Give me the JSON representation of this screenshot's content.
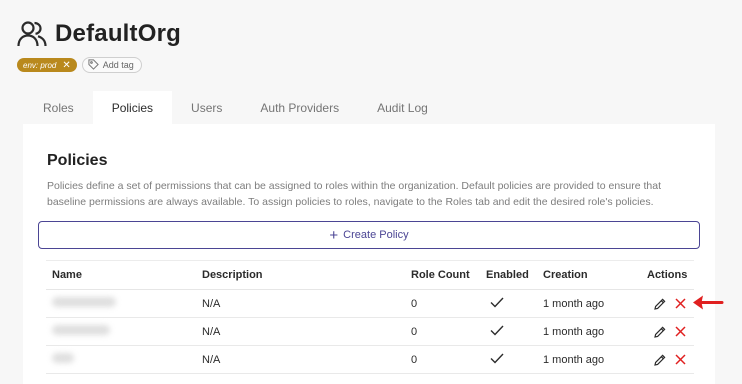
{
  "org": {
    "title": "DefaultOrg",
    "icon": "users-icon"
  },
  "tags": {
    "env_tag": "env: prod",
    "add_tag_label": "Add tag"
  },
  "tabs": [
    {
      "label": "Roles",
      "active": false
    },
    {
      "label": "Policies",
      "active": true
    },
    {
      "label": "Users",
      "active": false
    },
    {
      "label": "Auth Providers",
      "active": false
    },
    {
      "label": "Audit Log",
      "active": false
    }
  ],
  "policies": {
    "title": "Policies",
    "description": "Policies define a set of permissions that can be assigned to roles within the organization. Default policies are provided to ensure that baseline permissions are always available. To assign policies to roles, navigate to the Roles tab and edit the desired role's policies.",
    "create_label": "Create Policy",
    "columns": [
      "Name",
      "Description",
      "Role Count",
      "Enabled",
      "Creation",
      "Actions"
    ],
    "rows": [
      {
        "description": "N/A",
        "role_count": "0",
        "enabled": true,
        "creation": "1 month ago"
      },
      {
        "description": "N/A",
        "role_count": "0",
        "enabled": true,
        "creation": "1 month ago"
      },
      {
        "description": "N/A",
        "role_count": "0",
        "enabled": true,
        "creation": "1 month ago"
      }
    ]
  },
  "colors": {
    "accent": "#4b4594",
    "tag": "#b9891d",
    "danger": "#e02020"
  }
}
